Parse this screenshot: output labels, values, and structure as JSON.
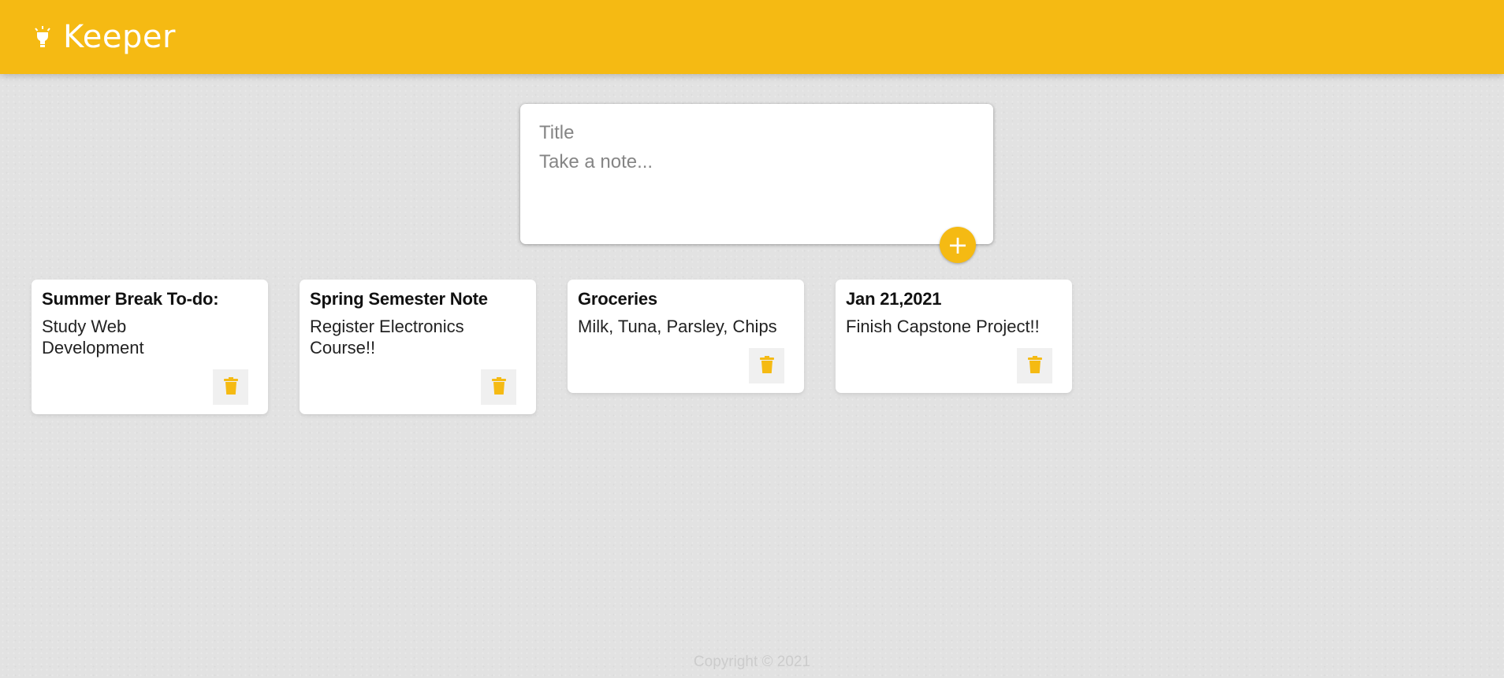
{
  "app": {
    "name": "Keeper",
    "icon": "lightbulb-icon",
    "brand_color": "#f5ba13"
  },
  "create_note": {
    "title_placeholder": "Title",
    "content_placeholder": "Take a note...",
    "add_button_label": "+",
    "add_icon": "plus-icon"
  },
  "notes": [
    {
      "title": "Summer Break To-do:",
      "content": "Study Web\nDevelopment",
      "delete_icon": "trash-icon"
    },
    {
      "title": "Spring Semester Note",
      "content": "Register Electronics\nCourse!!",
      "delete_icon": "trash-icon"
    },
    {
      "title": "Groceries",
      "content": "Milk, Tuna, Parsley, Chips",
      "delete_icon": "trash-icon"
    },
    {
      "title": "Jan 21,2021",
      "content": "Finish Capstone Project!!",
      "delete_icon": "trash-icon"
    }
  ],
  "footer": {
    "text": "Copyright © 2021"
  }
}
